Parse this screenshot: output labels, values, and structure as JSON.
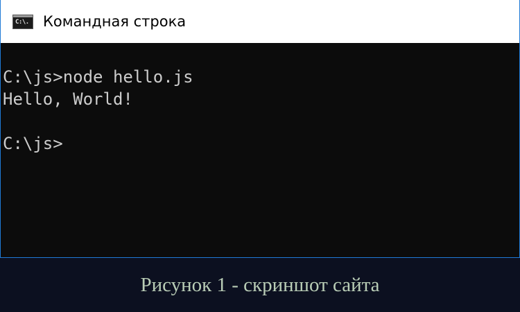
{
  "window": {
    "title": "Командная строка",
    "icon": "cmd-icon",
    "icon_text": "C:\\."
  },
  "console": {
    "lines": [
      "C:\\js>node hello.js",
      "Hello, World!",
      "C:\\js>"
    ]
  },
  "caption": "Рисунок 1 - скриншот сайта",
  "colors": {
    "console_bg": "#0c0c0c",
    "console_text": "#cccccc",
    "titlebar_bg": "#ffffff",
    "window_border": "#1f7ad6",
    "page_bg": "#0c1020",
    "caption_text": "#b9cdb6"
  }
}
